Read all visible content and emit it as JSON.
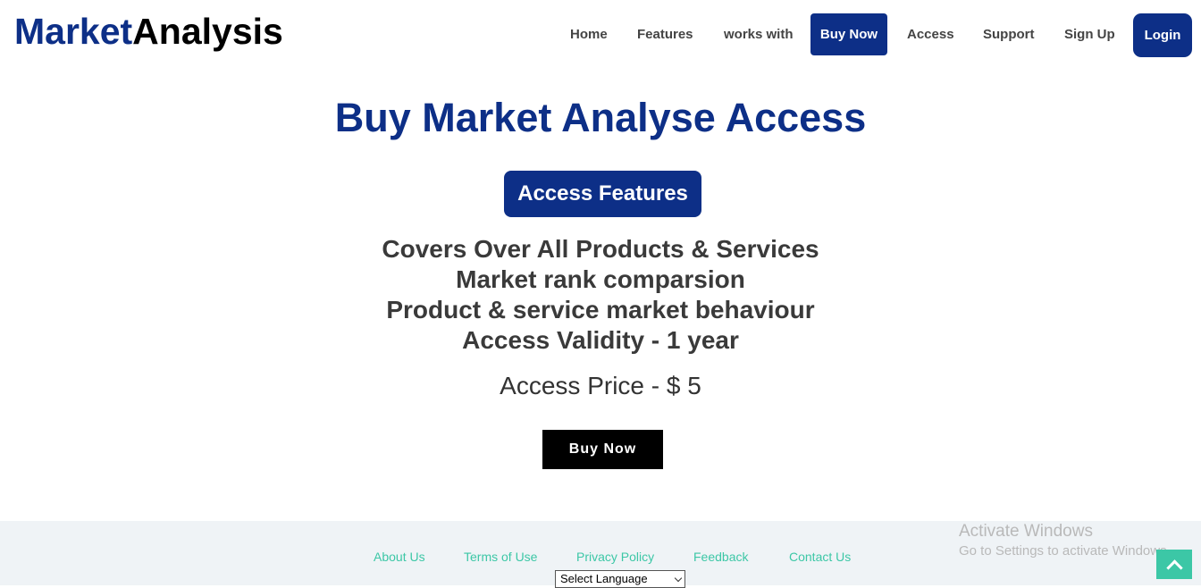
{
  "header": {
    "logo_part1": "Market",
    "logo_part2": "Analysis",
    "nav": {
      "home": "Home",
      "features": "Features",
      "works_with": "works with",
      "buy_now": "Buy Now",
      "access": "Access",
      "support": "Support",
      "sign_up": "Sign Up",
      "login": "Login"
    }
  },
  "main": {
    "title": "Buy Market Analyse Access",
    "features_badge": "Access Features",
    "features": [
      "Covers Over All Products & Services",
      "Market rank comparsion",
      "Product & service market behaviour",
      "Access Validity - 1 year"
    ],
    "price": "Access Price - $ 5",
    "buy_button": "Buy Now"
  },
  "footer": {
    "links": {
      "about": "About Us",
      "terms": "Terms of Use",
      "privacy": "Privacy Policy",
      "feedback": "Feedback",
      "contact": "Contact Us"
    },
    "language_select": "Select Language"
  },
  "watermark": {
    "line1": "Activate Windows",
    "line2": "Go to Settings to activate Windows."
  },
  "icons": {
    "scroll_top": "chevron-up-icon"
  },
  "colors": {
    "brand_blue": "#0d2f87",
    "accent_teal": "#3cc7a6"
  }
}
